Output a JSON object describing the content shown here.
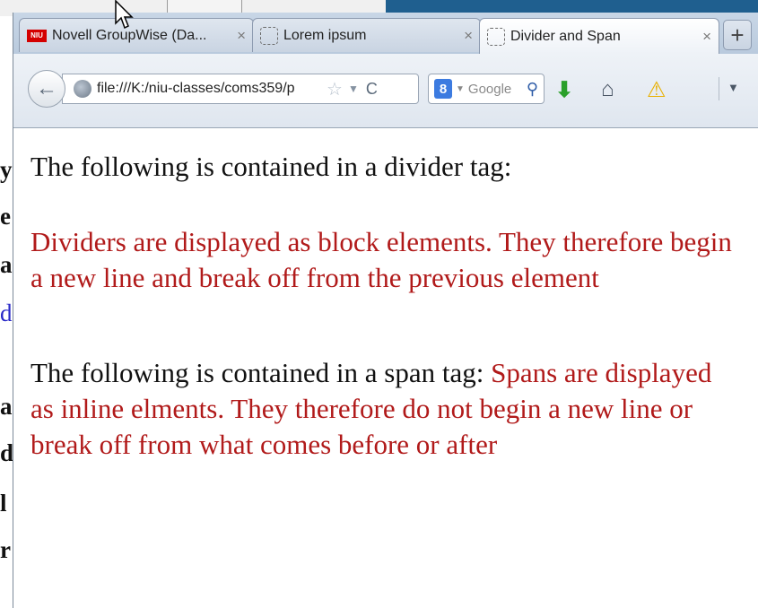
{
  "tabs": [
    {
      "label": "Novell GroupWise (Da...",
      "favicon": "niu-icon",
      "favicon_text": "NIU",
      "active": false
    },
    {
      "label": "Lorem ipsum",
      "favicon": "blank-page-icon",
      "active": false
    },
    {
      "label": "Divider and Span",
      "favicon": "blank-page-icon",
      "active": true
    }
  ],
  "tab_close_glyph": "×",
  "new_tab_glyph": "+",
  "navbar": {
    "url": "file:///K:/niu-classes/coms359/p",
    "search_engine_badge": "8",
    "search_placeholder": "Google"
  },
  "page": {
    "divider_intro": "The following is contained in a divider tag:",
    "divider_text": "Dividers are displayed as block elements. They therefore begin a new line and break off from the previous element",
    "span_intro": "The following is contained in a span tag: ",
    "span_text": "Spans are displayed as inline elments. They therefore do not begin a new line or break off from what comes before or after"
  },
  "background_fragments": [
    "y:",
    "e",
    "a",
    "d",
    "a",
    "d:",
    "l",
    "r"
  ],
  "colors": {
    "text_red": "#b11a1a",
    "text_dark": "#111111",
    "niu_red": "#d40000",
    "chrome_blue": "#c8d6e6"
  }
}
